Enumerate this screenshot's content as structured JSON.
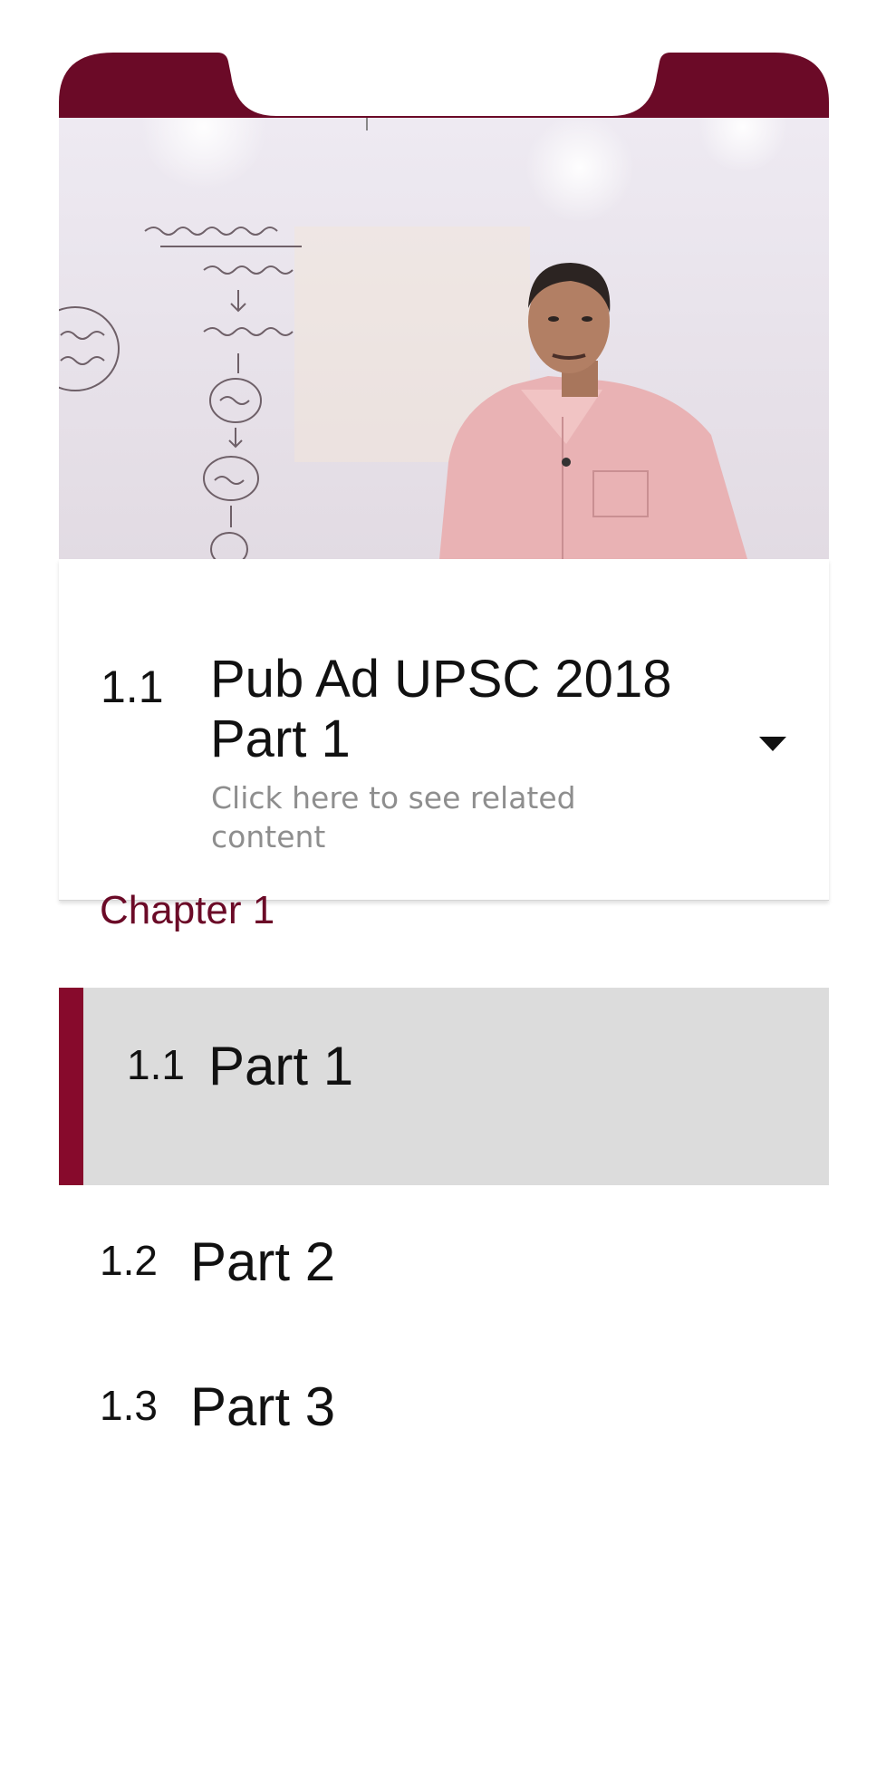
{
  "colors": {
    "brand": "#6b0a27",
    "active_bar": "#870a2c",
    "active_row": "#dcdcdc",
    "subtitle": "#8e8e8e"
  },
  "video": {
    "description_icon": "video-player"
  },
  "now_playing": {
    "number": "1.1",
    "title": "Pub Ad UPSC 2018 Part 1",
    "subtitle": "Click here to see related content",
    "toggle_icon": "caret-down-icon"
  },
  "chapter": {
    "title": "Chapter 1",
    "lessons": [
      {
        "number": "1.1",
        "label": "Part 1",
        "active": true
      },
      {
        "number": "1.2",
        "label": "Part 2",
        "active": false
      },
      {
        "number": "1.3",
        "label": "Part 3",
        "active": false
      }
    ]
  }
}
